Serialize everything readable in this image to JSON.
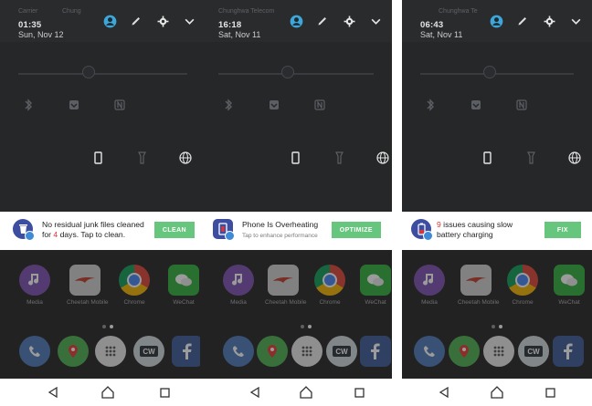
{
  "panels": [
    {
      "carrier": "Carrier",
      "carrier2": "Chung",
      "time": "01:35",
      "date": "Sun, Nov 12",
      "notification": {
        "title_pre": "No residual junk files cleaned for ",
        "title_highlight": "4",
        "title_post": " days. Tap to clean.",
        "subtitle": "",
        "cta": "CLEAN"
      }
    },
    {
      "carrier": "Chunghwa Telecom",
      "carrier2": "",
      "time": "16:18",
      "date": "Sat, Nov 11",
      "notification": {
        "title_pre": "Phone Is Overheating",
        "title_highlight": "",
        "title_post": "",
        "subtitle": "Tap to enhance performance",
        "cta": "OPTIMIZE"
      }
    },
    {
      "carrier": "Chunghwa Te",
      "carrier2": "",
      "time": "06:43",
      "date": "Sat, Nov 11",
      "notification": {
        "title_pre": "",
        "title_highlight": "9",
        "title_post": " issues causing slow battery charging",
        "subtitle": "",
        "cta": "FIX"
      }
    }
  ],
  "apps": {
    "media": "Media",
    "cheetah": "Cheetah Mobile",
    "chrome": "Chrome",
    "wechat": "WeChat"
  },
  "icons": {
    "header": [
      "account-icon",
      "edit-icon",
      "settings-icon",
      "chevron-down-icon"
    ],
    "quick_settings_row1": [
      "bluetooth-icon",
      "do-not-disturb-icon",
      "nfc-icon"
    ],
    "quick_settings_row2": [
      "phone-portrait-icon",
      "flashlight-icon",
      "globe-icon"
    ],
    "nav": [
      "back-icon",
      "home-icon",
      "recents-icon"
    ]
  },
  "colors": {
    "cta_green": "#67c67d",
    "highlight_red": "#e33232",
    "account_blue": "#3ea6d8",
    "shade_bg": "#262729"
  }
}
